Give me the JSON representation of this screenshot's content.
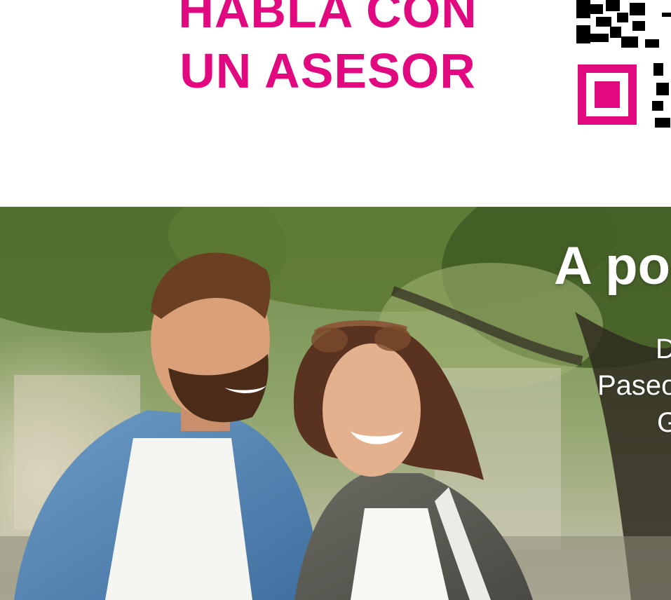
{
  "headline": {
    "line1": "HABLA CON",
    "line2": "UN ASESOR"
  },
  "promo": {
    "title": "A poc",
    "line1": "D",
    "line2": "Paseo",
    "line3": "G"
  },
  "colors": {
    "brand_pink": "#e2087f",
    "text_on_photo": "#ffffff"
  },
  "icons": {
    "qr": "qr-code-icon"
  }
}
